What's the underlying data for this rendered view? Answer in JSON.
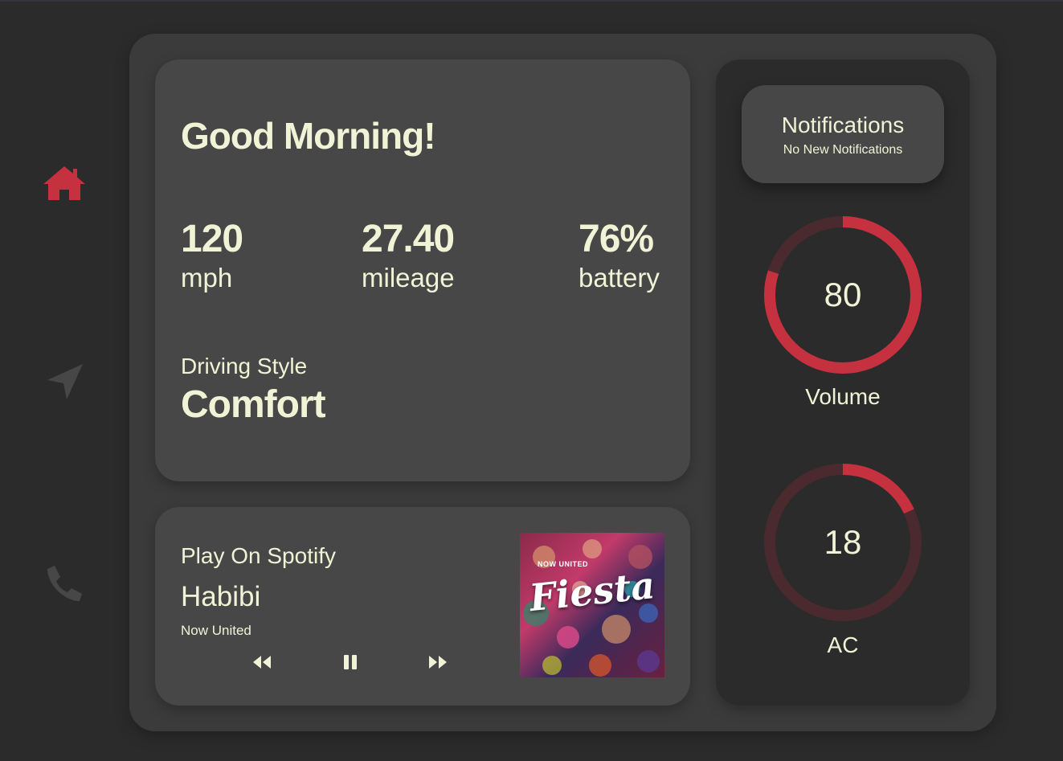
{
  "nav": {
    "items": [
      {
        "icon": "home-icon",
        "active": true
      },
      {
        "icon": "navigation-arrow-icon",
        "active": false
      },
      {
        "icon": "phone-icon",
        "active": false
      }
    ]
  },
  "dashboard": {
    "greeting": "Good Morning!",
    "stats": {
      "speed": {
        "value": "120",
        "label": "mph"
      },
      "mileage": {
        "value": "27.40",
        "label": "mileage"
      },
      "battery": {
        "value": "76%",
        "label": "battery"
      }
    },
    "driving_style": {
      "label": "Driving Style",
      "value": "Comfort"
    }
  },
  "music": {
    "source": "Play On Spotify",
    "title": "Habibi",
    "artist": "Now United",
    "album_art_text": "Fiesta",
    "album_brand": "NOW UNITED",
    "controls": [
      "rewind-icon",
      "pause-icon",
      "fast-forward-icon"
    ]
  },
  "notifications": {
    "title": "Notifications",
    "subtitle": "No New Notifications"
  },
  "dials": {
    "volume": {
      "value": "80",
      "label": "Volume",
      "level": 0.8
    },
    "ac": {
      "value": "18",
      "label": "AC",
      "level": 0.18
    }
  },
  "colors": {
    "accent": "#c6313f",
    "track": "#4a2a2e",
    "text": "#f1f3d6",
    "inactive_icon": "#474747"
  }
}
